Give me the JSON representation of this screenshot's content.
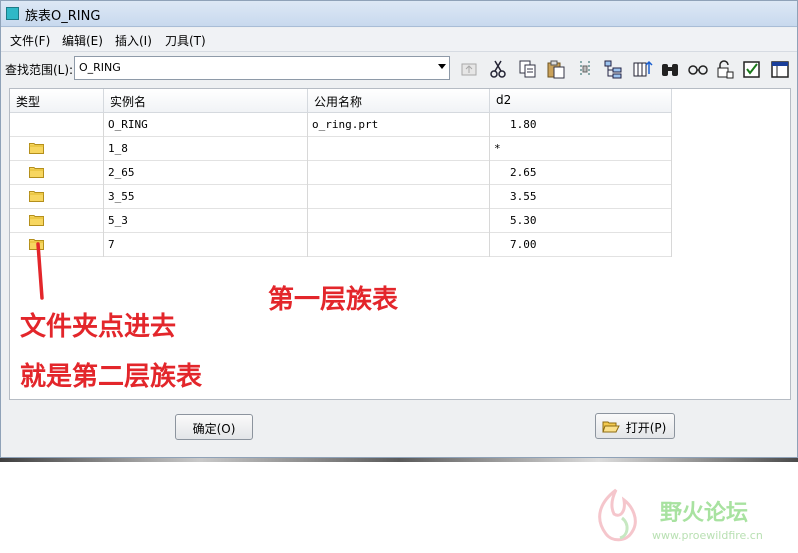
{
  "window": {
    "title": "族表O_RING"
  },
  "menu": [
    "文件(F)",
    "编辑(E)",
    "插入(I)",
    "刀具(T)"
  ],
  "lookin": {
    "label": "查找范围(L):",
    "value": "O_RING"
  },
  "toolbar_icons": [
    "up-folder-icon",
    "cut-icon",
    "copy-icon",
    "paste-icon",
    "zipper-icon",
    "tree-view-icon",
    "table-columns-icon",
    "binoculars-icon",
    "glasses-icon",
    "lock-icon",
    "checkbox-icon",
    "window-icon"
  ],
  "table": {
    "headers": [
      "类型",
      "实例名",
      "公用名称",
      "d2"
    ],
    "rows": [
      {
        "folder": false,
        "instance": "O_RING",
        "common": "o_ring.prt",
        "d2": "1.80"
      },
      {
        "folder": true,
        "instance": "1_8",
        "common": "",
        "d2": "*"
      },
      {
        "folder": true,
        "instance": "2_65",
        "common": "",
        "d2": "2.65"
      },
      {
        "folder": true,
        "instance": "3_55",
        "common": "",
        "d2": "3.55"
      },
      {
        "folder": true,
        "instance": "5_3",
        "common": "",
        "d2": "5.30"
      },
      {
        "folder": true,
        "instance": "7",
        "common": "",
        "d2": "7.00"
      }
    ]
  },
  "buttons": {
    "ok": "确定(O)",
    "open": "打开(P)"
  },
  "annotations": {
    "first_level": "第一层族表",
    "line1": "文件夹点进去",
    "line2": "就是第二层族表"
  },
  "watermark": {
    "text": "野火论坛",
    "url": "www.proewildfire.cn"
  },
  "colors": {
    "annotation": "#e3262b",
    "folder": "#f7d660",
    "watermark": "#a8e2a0"
  }
}
